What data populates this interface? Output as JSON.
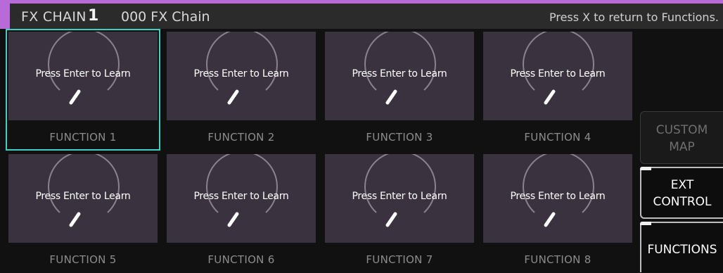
{
  "header": {
    "title": "FX CHAIN",
    "chain_number": "1",
    "preset_name": "000 FX Chain",
    "hint": "Press X to return to Functions."
  },
  "functions": [
    {
      "label": "FUNCTION 1",
      "knob_text": "Press Enter to Learn",
      "selected": true
    },
    {
      "label": "FUNCTION 2",
      "knob_text": "Press Enter to Learn",
      "selected": false
    },
    {
      "label": "FUNCTION 3",
      "knob_text": "Press Enter to Learn",
      "selected": false
    },
    {
      "label": "FUNCTION 4",
      "knob_text": "Press Enter to Learn",
      "selected": false
    },
    {
      "label": "FUNCTION 5",
      "knob_text": "Press Enter to Learn",
      "selected": false
    },
    {
      "label": "FUNCTION 6",
      "knob_text": "Press Enter to Learn",
      "selected": false
    },
    {
      "label": "FUNCTION 7",
      "knob_text": "Press Enter to Learn",
      "selected": false
    },
    {
      "label": "FUNCTION 8",
      "knob_text": "Press Enter to Learn",
      "selected": false
    }
  ],
  "side_buttons": {
    "custom_map": [
      "CUSTOM",
      "MAP"
    ],
    "ext_control": [
      "EXT",
      "CONTROL"
    ],
    "functions": "FUNCTIONS"
  },
  "colors": {
    "accent": "#b86ad8",
    "selection": "#3fd0c0",
    "knob_panel": "#3a333f"
  }
}
